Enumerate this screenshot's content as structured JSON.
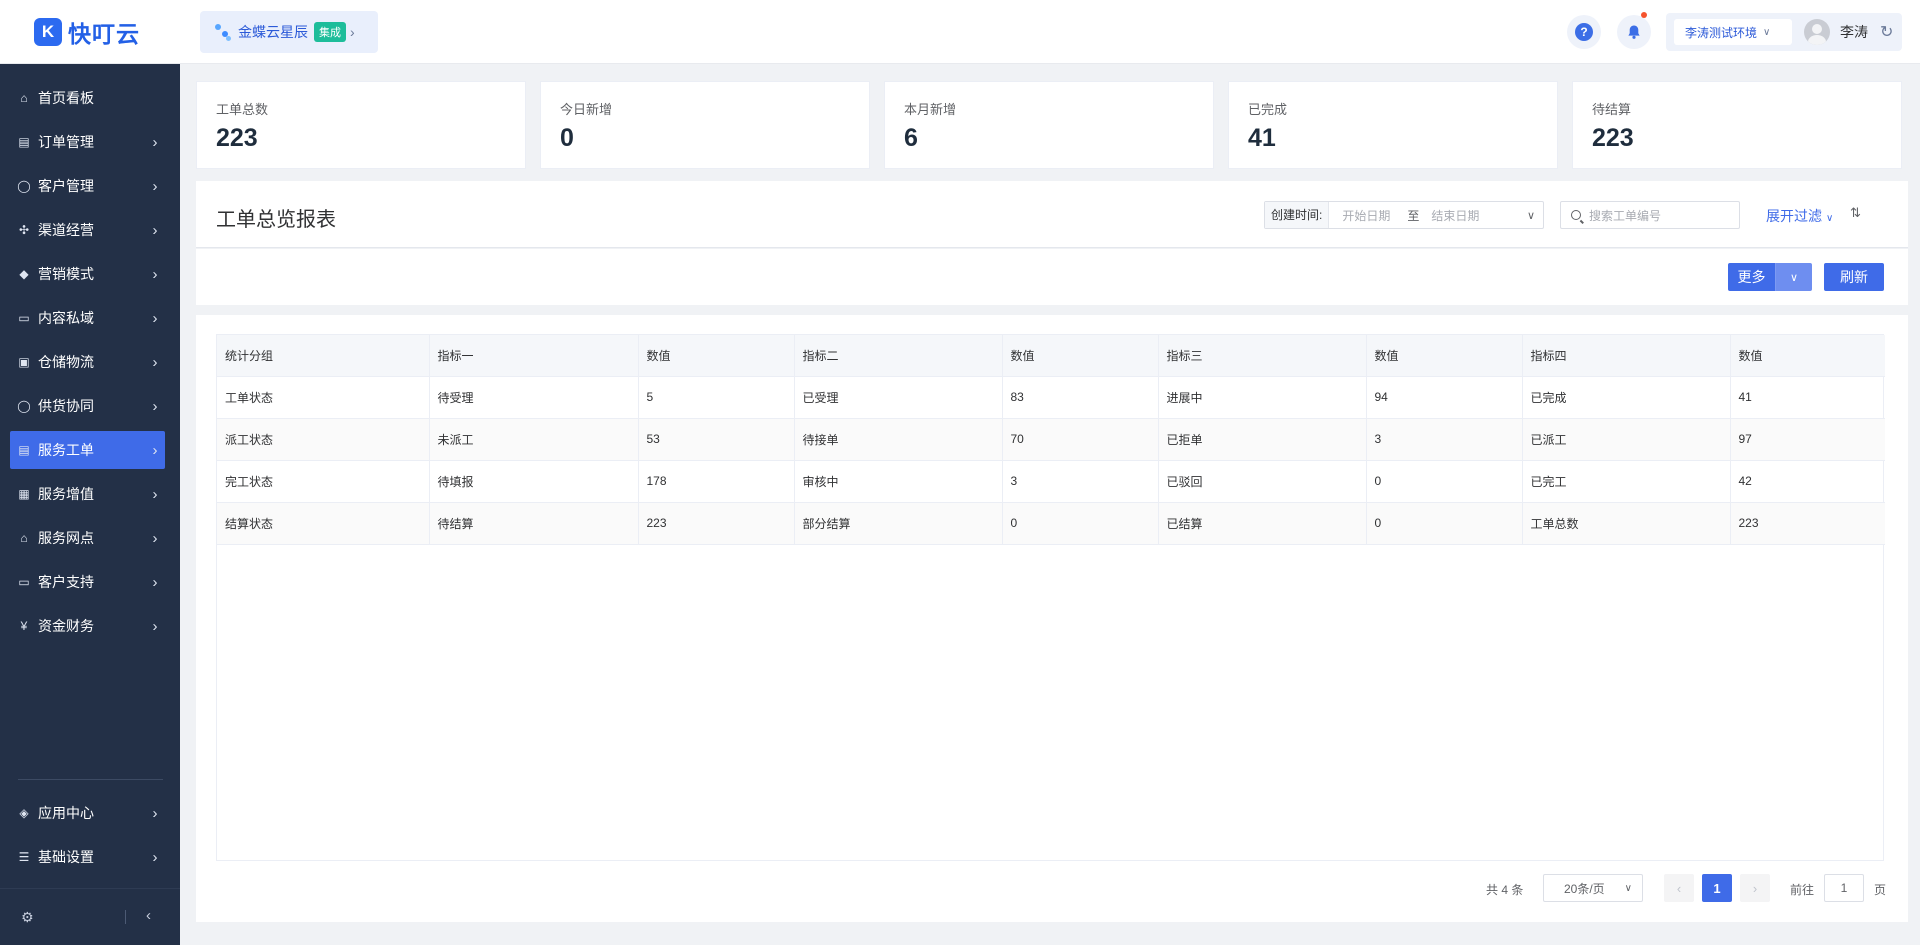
{
  "app": {
    "logo_text": "快叮云",
    "logo_glyph": "K"
  },
  "org": {
    "name": "金蝶云星辰",
    "tag": "集成"
  },
  "header": {
    "help_glyph": "?",
    "environment": "李涛测试环境",
    "user_name": "李涛"
  },
  "sidebar": {
    "items": [
      {
        "label": "首页看板",
        "icon": "home-icon",
        "glyph": "⌂",
        "has_children": false,
        "active": false
      },
      {
        "label": "订单管理",
        "icon": "clipboard-icon",
        "glyph": "▤",
        "has_children": true,
        "active": false
      },
      {
        "label": "客户管理",
        "icon": "user-icon",
        "glyph": "◯",
        "has_children": true,
        "active": false
      },
      {
        "label": "渠道经营",
        "icon": "channel-icon",
        "glyph": "✣",
        "has_children": true,
        "active": false
      },
      {
        "label": "营销模式",
        "icon": "tag-icon",
        "glyph": "◆",
        "has_children": true,
        "active": false
      },
      {
        "label": "内容私域",
        "icon": "image-icon",
        "glyph": "▭",
        "has_children": true,
        "active": false
      },
      {
        "label": "仓储物流",
        "icon": "box-icon",
        "glyph": "▣",
        "has_children": true,
        "active": false
      },
      {
        "label": "供货协同",
        "icon": "supplier-icon",
        "glyph": "◯",
        "has_children": true,
        "active": false
      },
      {
        "label": "服务工单",
        "icon": "work-order-icon",
        "glyph": "▤",
        "has_children": true,
        "active": true
      },
      {
        "label": "服务增值",
        "icon": "gift-icon",
        "glyph": "▦",
        "has_children": true,
        "active": false
      },
      {
        "label": "服务网点",
        "icon": "shop-icon",
        "glyph": "⌂",
        "has_children": true,
        "active": false
      },
      {
        "label": "客户支持",
        "icon": "support-icon",
        "glyph": "▭",
        "has_children": true,
        "active": false
      },
      {
        "label": "资金财务",
        "icon": "yen-icon",
        "glyph": "¥",
        "has_children": true,
        "active": false
      }
    ],
    "bottom_items": [
      {
        "label": "应用中心",
        "icon": "cube-icon",
        "glyph": "◈",
        "has_children": true
      },
      {
        "label": "基础设置",
        "icon": "sliders-icon",
        "glyph": "☰",
        "has_children": true
      }
    ]
  },
  "stats": [
    {
      "title": "工单总数",
      "value": "223"
    },
    {
      "title": "今日新增",
      "value": "0"
    },
    {
      "title": "本月新增",
      "value": "6"
    },
    {
      "title": "已完成",
      "value": "41"
    },
    {
      "title": "待结算",
      "value": "223"
    }
  ],
  "report": {
    "title": "工单总览报表",
    "date_label": "创建时间:",
    "date_start_placeholder": "开始日期",
    "date_separator": "至",
    "date_end_placeholder": "结束日期",
    "search_placeholder": "搜索工单编号",
    "filter_toggle": "展开过滤",
    "more_button": "更多",
    "refresh_button": "刷新"
  },
  "table": {
    "columns": [
      "统计分组",
      "指标一",
      "数值",
      "指标二",
      "数值",
      "指标三",
      "数值",
      "指标四",
      "数值"
    ],
    "rows": [
      [
        "工单状态",
        "待受理",
        "5",
        "已受理",
        "83",
        "进展中",
        "94",
        "已完成",
        "41"
      ],
      [
        "派工状态",
        "未派工",
        "53",
        "待接单",
        "70",
        "已拒单",
        "3",
        "已派工",
        "97"
      ],
      [
        "完工状态",
        "待填报",
        "178",
        "审核中",
        "3",
        "已驳回",
        "0",
        "已完工",
        "42"
      ],
      [
        "结算状态",
        "待结算",
        "223",
        "部分结算",
        "0",
        "已结算",
        "0",
        "工单总数",
        "223"
      ]
    ]
  },
  "pagination": {
    "total_text": "共 4 条",
    "page_size": "20条/页",
    "current_page": "1",
    "goto_label": "前往",
    "goto_value": "1",
    "page_unit": "页"
  },
  "colors": {
    "primary": "#3f6be8",
    "sidebar_bg": "#233047",
    "badge": "#1dbd9a",
    "notify_dot": "#f5532d"
  }
}
